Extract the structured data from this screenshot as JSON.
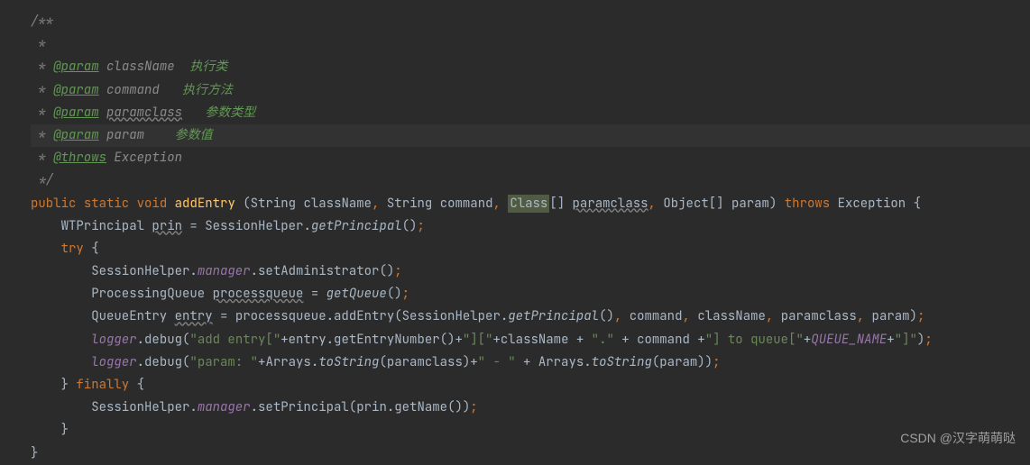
{
  "javadoc": {
    "open": "/**",
    "star": " *",
    "tag_param": "@param",
    "tag_throws": "@throws",
    "lines": [
      {
        "name": "className",
        "desc": "执行类",
        "wavy": false
      },
      {
        "name": "command",
        "desc": "执行方法",
        "wavy": false
      },
      {
        "name": "paramclass",
        "desc": "参数类型",
        "wavy": true
      },
      {
        "name": "param",
        "desc": "参数值",
        "wavy": false
      }
    ],
    "throws_text": "Exception",
    "close": " */"
  },
  "tokens": {
    "public": "public",
    "static": "static",
    "void": "void",
    "try": "try",
    "finally": "finally",
    "throws": "throws"
  },
  "method": {
    "name": "addEntry",
    "param_types": {
      "t1": "String",
      "t2": "String",
      "t3": "Class",
      "t4": "Object[]"
    },
    "param_names": {
      "p1": "className",
      "p2": "command",
      "p3": "paramclass",
      "p4": "param"
    },
    "throws": "Exception"
  },
  "body": {
    "prin_type": "WTPrincipal",
    "prin_var": "prin",
    "session_helper": "SessionHelper",
    "get_principal": "getPrincipal",
    "manager": "manager",
    "set_admin": "setAdministrator",
    "pq_type": "ProcessingQueue",
    "pq_var": "processqueue",
    "get_queue": "getQueue",
    "qe_type": "QueueEntry",
    "qe_var": "entry",
    "add_entry": "addEntry",
    "get_principal2": "getPrincipal",
    "args": {
      "a1": "command",
      "a2": "className",
      "a3": "paramclass",
      "a4": "param"
    },
    "logger": "logger",
    "debug": "debug",
    "s_add_entry": "\"add entry[\"",
    "get_entry_num": "getEntryNumber",
    "s_br": "\"][\"",
    "s_dot": "\".\"",
    "s_toqueue": "\"] to queue[\"",
    "queue_name": "QUEUE_NAME",
    "s_close": "\"]\"",
    "s_param": "\"param: \"",
    "arrays": "Arrays",
    "tostring": "toString",
    "s_dash": "\" - \"",
    "set_principal": "setPrincipal",
    "get_name": "getName"
  },
  "watermark": "CSDN @汉字萌萌哒"
}
